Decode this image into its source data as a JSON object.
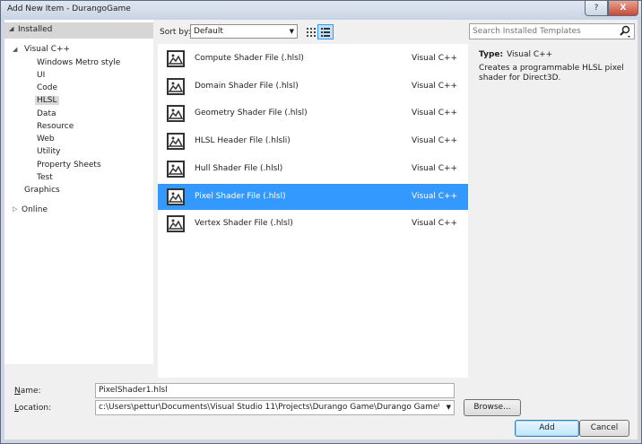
{
  "window": {
    "title": "Add New Item - DurangoGame",
    "help_label": "?",
    "close_label": "X"
  },
  "tree": {
    "installed": {
      "label": "Installed",
      "arrow": "◢"
    },
    "visual_cpp": {
      "label": "Visual C++",
      "arrow": "◢"
    },
    "children": [
      {
        "label": "Windows Metro style"
      },
      {
        "label": "UI"
      },
      {
        "label": "Code"
      },
      {
        "label": "HLSL"
      },
      {
        "label": "Data"
      },
      {
        "label": "Resource"
      },
      {
        "label": "Web"
      },
      {
        "label": "Utility"
      },
      {
        "label": "Property Sheets"
      },
      {
        "label": "Test"
      }
    ],
    "graphics": {
      "label": "Graphics"
    },
    "online": {
      "label": "Online",
      "arrow": "▷"
    }
  },
  "sort": {
    "label": "Sort by:",
    "value": "Default",
    "dd_icon": "▼"
  },
  "templates": [
    {
      "name": "Compute Shader File (.hlsl)",
      "lang": "Visual C++",
      "selected": false
    },
    {
      "name": "Domain Shader File (.hlsl)",
      "lang": "Visual C++",
      "selected": false
    },
    {
      "name": "Geometry Shader File (.hlsl)",
      "lang": "Visual C++",
      "selected": false
    },
    {
      "name": "HLSL Header File (.hlsli)",
      "lang": "Visual C++",
      "selected": false
    },
    {
      "name": "Hull Shader File (.hlsl)",
      "lang": "Visual C++",
      "selected": false
    },
    {
      "name": "Pixel Shader File (.hlsl)",
      "lang": "Visual C++",
      "selected": true
    },
    {
      "name": "Vertex Shader File (.hlsl)",
      "lang": "Visual C++",
      "selected": false
    }
  ],
  "search": {
    "placeholder": "Search Installed Templates"
  },
  "details": {
    "type_label": "Type:",
    "type_value": "Visual C++",
    "description": "Creates a programmable HLSL pixel shader for Direct3D."
  },
  "form": {
    "name_label_u": "N",
    "name_label_rest": "ame:",
    "name_value": "PixelShader1.hlsl",
    "location_label_u": "L",
    "location_label_rest": "ocation:",
    "location_value": "c:\\Users\\pettur\\Documents\\Visual Studio 11\\Projects\\Durango Game\\Durango Game\\",
    "location_dd_icon": "▼"
  },
  "buttons": {
    "browse": "Browse...",
    "add": "Add",
    "cancel": "Cancel"
  },
  "colors": {
    "selection": "#3399ff",
    "title_gradient_top": "#dfe7f1",
    "close": "#c74a37"
  }
}
